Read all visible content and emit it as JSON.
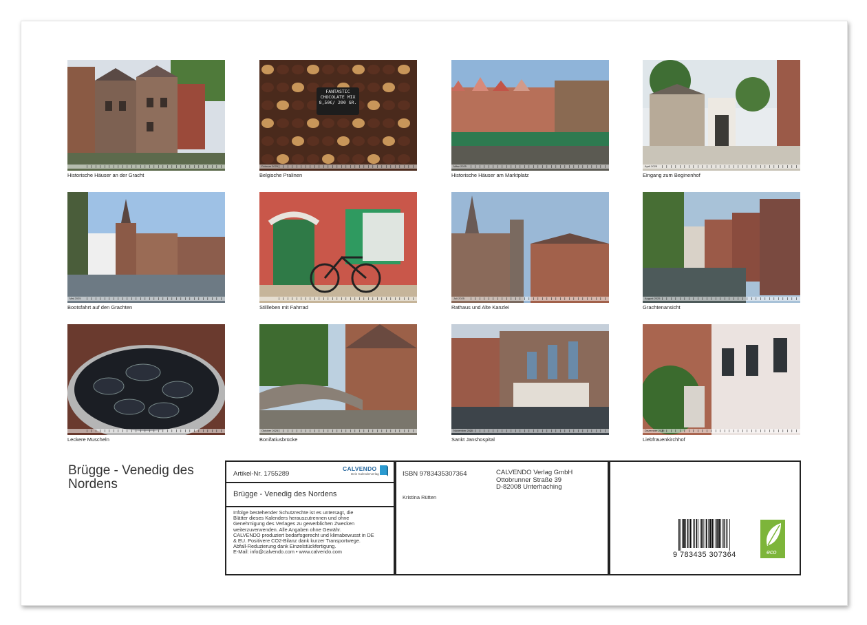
{
  "title": "Brügge - Venedig des Nordens",
  "photos": [
    {
      "caption": "Historische Häuser an der Gracht",
      "month": ""
    },
    {
      "caption": "Belgische Pralinen",
      "month": "Februar 2025",
      "sign": [
        "FANTASTIC",
        "CHOCOLATE MIX",
        "8,50€/ 200 GR."
      ]
    },
    {
      "caption": "Historische Häuser am Marktplatz",
      "month": "März 2025"
    },
    {
      "caption": "Eingang zum Beginenhof",
      "month": "April 2025"
    },
    {
      "caption": "Bootsfahrt auf den Grachten",
      "month": "Mai 2025"
    },
    {
      "caption": "Stillleben mit Fahrrad",
      "month": ""
    },
    {
      "caption": "Rathaus und Alte Kanzlei",
      "month": "Juli 2025"
    },
    {
      "caption": "Grachtenansicht",
      "month": "August 2025"
    },
    {
      "caption": "Leckere Muscheln",
      "month": ""
    },
    {
      "caption": "Bonifatiusbrücke",
      "month": "Oktober 2025"
    },
    {
      "caption": "Sankt Janshospital",
      "month": "November 2025"
    },
    {
      "caption": "Liebfrauenkirchhof",
      "month": "Dezember 2025"
    }
  ],
  "info": {
    "article": "Artikel-Nr. 1755289",
    "logo_text": "CALVENDO",
    "logo_sub": "Dein Kalenderverlag",
    "book_title": "Brügge - Venedig des Nordens",
    "legal_lines": [
      "Infolge bestehender Schutzrechte ist es untersagt, die",
      "Blätter dieses Kalenders herauszutrennen und ohne",
      "Genehmigung des Verlages zu gewerblichen Zwecken",
      "weiterzuverwenden. Alle Angaben ohne Gewähr.",
      "CALVENDO produziert bedarfsgerecht und klimabewusst in DE",
      "& EU. Positivere CO2-Bilanz dank kurzer Transportwege.",
      "Abfall-Reduzierung dank Einzelstückfertigung.",
      "E-Mail: info@calvendo.com • www.calvendo.com"
    ],
    "isbn": "ISBN 9783435307364",
    "author": "Kristina Rütten",
    "publisher_lines": [
      "CALVENDO Verlag GmbH",
      "Ottobrunner Straße 39",
      "D-82008 Unterhaching"
    ],
    "barcode_text": "9 783435 307364",
    "eco_label": "eco"
  },
  "colors": {
    "frame": "#222222",
    "eco_green": "#7db53a",
    "logo_blue": "#2a9ad0"
  }
}
